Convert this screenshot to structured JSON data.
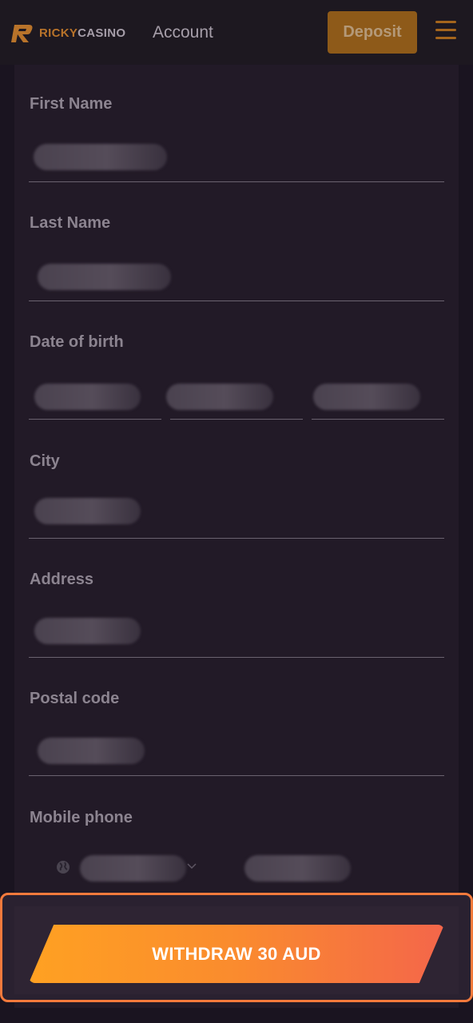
{
  "header": {
    "logo_ricky": "RICKY",
    "logo_casino": "CASINO",
    "account_label": "Account",
    "deposit_label": "Deposit"
  },
  "form": {
    "first_name_label": "First Name",
    "last_name_label": "Last Name",
    "dob_label": "Date of birth",
    "city_label": "City",
    "address_label": "Address",
    "postal_code_label": "Postal code",
    "mobile_phone_label": "Mobile phone"
  },
  "cta": {
    "withdraw_label": "WITHDRAW 30 AUD"
  },
  "colors": {
    "accent": "#f47a3c",
    "deposit": "#8e5a19",
    "background": "#1a1420"
  }
}
